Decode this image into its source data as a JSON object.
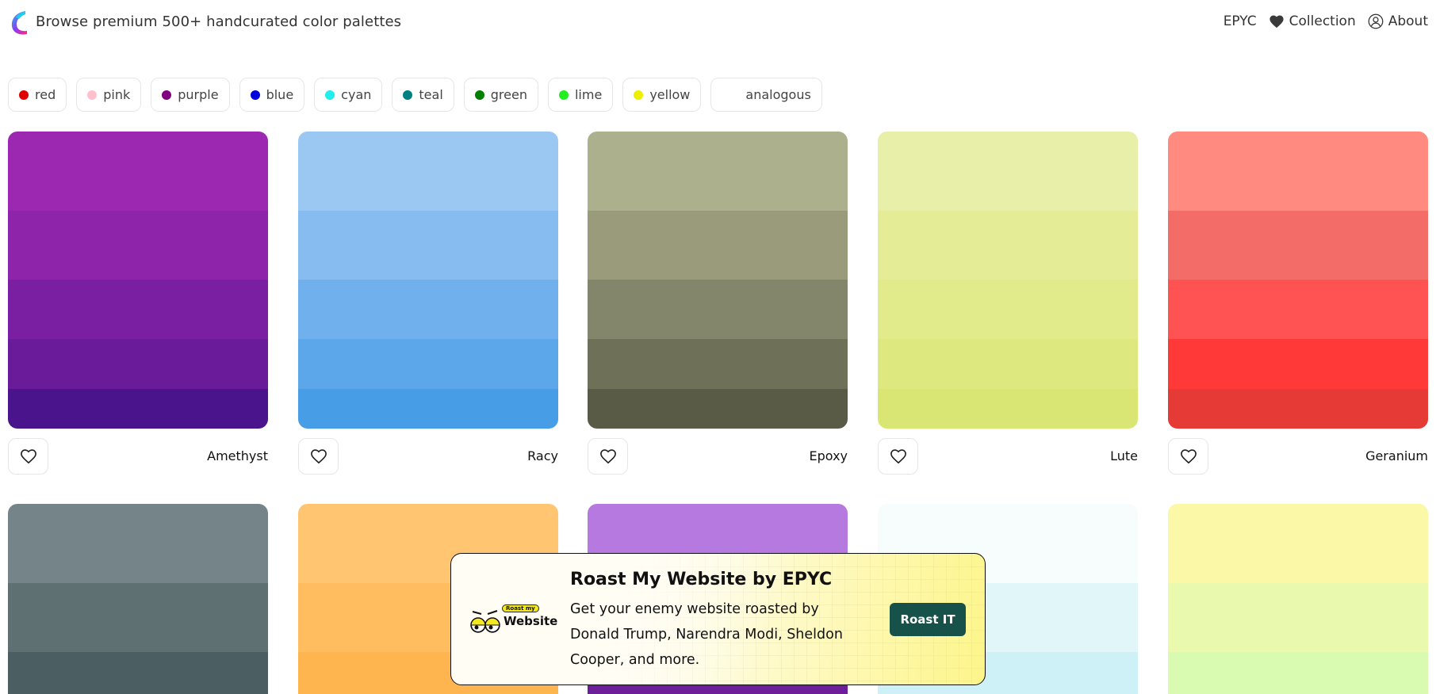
{
  "header": {
    "title": "Browse premium 500+ handcurated color palettes",
    "nav": [
      {
        "label": "EPYC",
        "icon": "none"
      },
      {
        "label": "Collection",
        "icon": "heart-icon"
      },
      {
        "label": "About",
        "icon": "user-icon"
      }
    ]
  },
  "filters": [
    {
      "label": "red",
      "color": "#e00000"
    },
    {
      "label": "pink",
      "color": "#ffc0cb"
    },
    {
      "label": "purple",
      "color": "#800080"
    },
    {
      "label": "blue",
      "color": "#0000dd"
    },
    {
      "label": "cyan",
      "color": "#22eeee"
    },
    {
      "label": "teal",
      "color": "#008080"
    },
    {
      "label": "green",
      "color": "#008000"
    },
    {
      "label": "lime",
      "color": "#22ee22"
    },
    {
      "label": "yellow",
      "color": "#eeee00"
    },
    {
      "label": "analogous",
      "color": ""
    }
  ],
  "palettes_row1": [
    {
      "name": "Amethyst",
      "colors": [
        "#9c27b0",
        "#8e24aa",
        "#7b1fa2",
        "#6a1b9a",
        "#4a148c"
      ]
    },
    {
      "name": "Racy",
      "colors": [
        "#9bc7f3",
        "#86bcf0",
        "#70b0ed",
        "#5ca6ea",
        "#479de6"
      ]
    },
    {
      "name": "Epoxy",
      "colors": [
        "#acb08c",
        "#999b7b",
        "#84866b",
        "#6e7058",
        "#5a5b47"
      ]
    },
    {
      "name": "Lute",
      "colors": [
        "#e8efa8",
        "#e4ed96",
        "#e1eb8b",
        "#dde97f",
        "#dae673"
      ]
    },
    {
      "name": "Geranium",
      "colors": [
        "#ff8a80",
        "#f36c67",
        "#ff5252",
        "#ff3838",
        "#e53a35"
      ]
    }
  ],
  "palettes_row2": [
    {
      "colors": [
        "#758488",
        "#5f7073",
        "#4b5e61"
      ]
    },
    {
      "colors": [
        "#ffc571",
        "#ffbd60",
        "#ffb54f"
      ]
    },
    {
      "colors": [
        "#b679df",
        "#9b4fcf",
        "#6d1f9a"
      ]
    },
    {
      "colors": [
        "#f7fcfd",
        "#e0f6f8",
        "#cdf1f6"
      ]
    },
    {
      "colors": [
        "#fbf9a8",
        "#e9f9ad",
        "#d8fab1"
      ]
    }
  ],
  "banner": {
    "title": "Roast My Website by EPYC",
    "text": "Get your enemy website roasted by Donald Trump, Narendra Modi, Sheldon Cooper, and more.",
    "button": "Roast IT",
    "logo_small": "Roast my",
    "logo_big": "Website"
  },
  "colors": {
    "accent_button": "#17524a"
  }
}
